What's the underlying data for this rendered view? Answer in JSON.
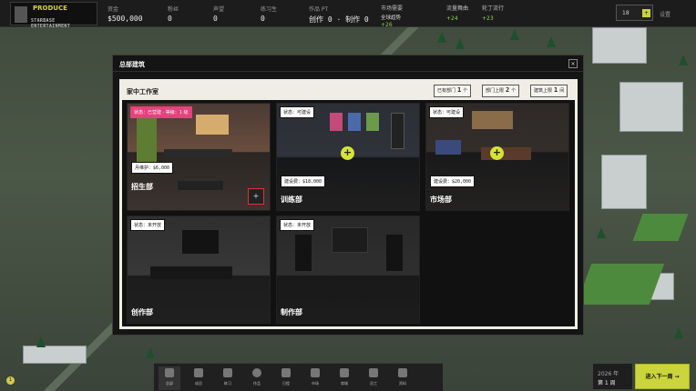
{
  "topbar": {
    "logo_line1": "PRODUCE",
    "logo_line2": "STARBASE ENTERTAINMENT",
    "stats": [
      {
        "label": "资金",
        "value": "$500,000"
      },
      {
        "label": "粉丝",
        "value": "0"
      },
      {
        "label": "声望",
        "value": "0"
      },
      {
        "label": "练习生",
        "value": "0"
      },
      {
        "label": "作品 PT",
        "value": "创作 0 · 制作 0"
      }
    ],
    "trends": [
      {
        "title": "市场需要",
        "sub": "全球趋势",
        "value": "+26"
      },
      {
        "title": "流量舞曲",
        "value": "+24"
      },
      {
        "title": "轮丁流行",
        "value": "+23"
      }
    ],
    "control_value": "18",
    "control_btn": "+",
    "settings_label": "设置"
  },
  "modal": {
    "title": "总部建筑",
    "close": "×",
    "section_title": "家中工作室",
    "pills": [
      {
        "label": "已有部门",
        "value": "1",
        "unit": "个"
      },
      {
        "label": "部门上限",
        "value": "2",
        "unit": "个"
      },
      {
        "label": "建筑上限",
        "value": "1",
        "unit": "间"
      }
    ],
    "departments": [
      {
        "status": "状态：已营建 · 等级：1 级",
        "info": "月维护：$6,000",
        "name": "招生部",
        "action": "+"
      },
      {
        "status": "状态：可建设",
        "info": "建设费：$18,000",
        "name": "训练部",
        "action": "+"
      },
      {
        "status": "状态：可建设",
        "info": "建设费：$20,000",
        "name": "市场部",
        "action": "+"
      },
      {
        "status": "状态：未开放",
        "name": "创作部"
      },
      {
        "status": "状态：未开放",
        "name": "制作部"
      }
    ]
  },
  "bottombar": {
    "items": [
      "总部",
      "成员",
      "练习",
      "作品",
      "日程",
      "市场",
      "商城",
      "员工",
      "资料"
    ]
  },
  "week": {
    "year": "2026 年",
    "week": "第 1 周"
  },
  "next_label": "进入下一周 →",
  "badge": "1",
  "colors": {
    "accent": "#cbd43a",
    "status_pink": "#e8407c",
    "trend_green": "#8fd14f"
  }
}
